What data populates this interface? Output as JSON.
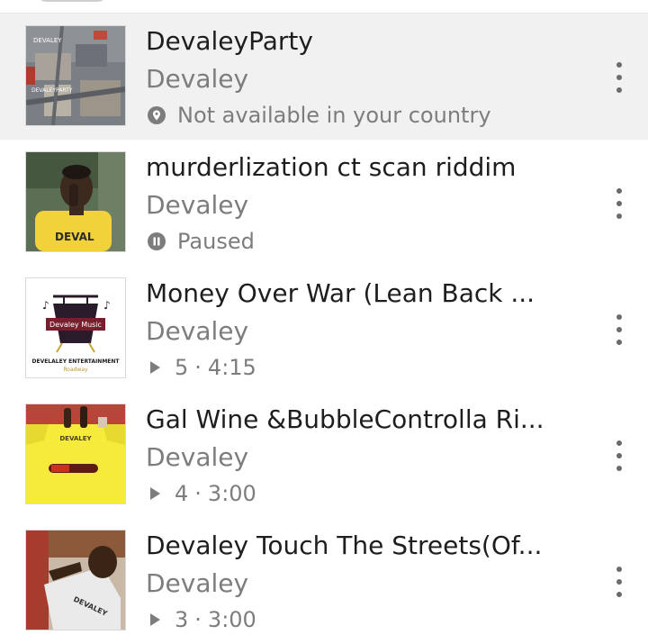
{
  "tracks": [
    {
      "title": "DevaleyParty",
      "artist": "Devaley",
      "status_icon": "location-pin-icon",
      "status_text": "Not available in your country",
      "highlighted": true,
      "art_labels": [
        "DEVALEY",
        "DEVALEYPARTY"
      ]
    },
    {
      "title": "murderlization  ct scan riddim",
      "artist": "Devaley",
      "status_icon": "pause-circle-icon",
      "status_text": "Paused",
      "art_labels": [
        "DEVAL"
      ]
    },
    {
      "title": "Money Over War (Lean Back ...",
      "artist": "Devaley",
      "status_icon": "play-icon",
      "plays": "5",
      "duration": "4:15",
      "art_labels": [
        "Devaley Music",
        "DEVELALEY ENTERTAINMENT",
        "Roadway"
      ]
    },
    {
      "title": "Gal Wine &BubbleControlla Ri...",
      "artist": "Devaley",
      "status_icon": "play-icon",
      "plays": "4",
      "duration": "3:00",
      "art_labels": [
        "DEVALEY"
      ]
    },
    {
      "title": "Devaley Touch The Streets(Of...",
      "artist": "Devaley",
      "status_icon": "play-icon",
      "plays": "3",
      "duration": "3:00",
      "art_labels": [
        "DEVALEY"
      ]
    }
  ],
  "separator": "·",
  "colors": {
    "highlight_row": "#f1f1f1",
    "title": "#1e1e1e",
    "secondary": "#7d7d7d"
  }
}
